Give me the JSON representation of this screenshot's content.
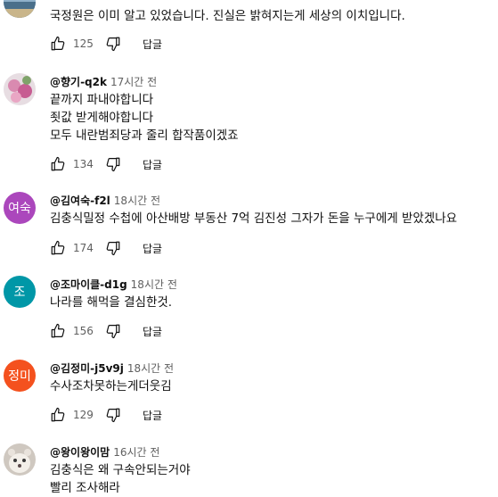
{
  "comments": [
    {
      "author": "",
      "time": "",
      "avatar_text": "",
      "avatar_kind": "photo-sea",
      "lines": [
        "국정원은 이미 알고 있었습니다.  진실은 밝혀지는게 세상의 이치입니다."
      ],
      "likes": "125",
      "reply_label": "답글"
    },
    {
      "author": "@향기-q2k",
      "time": "17시간 전",
      "avatar_text": "",
      "avatar_kind": "photo-flower",
      "lines": [
        "끝까지 파내야합니다",
        "죗값 받게해야합니다",
        "모두 내란범죄당과  줄리 합작품이겠죠"
      ],
      "likes": "134",
      "reply_label": "답글"
    },
    {
      "author": "@김여숙-f2l",
      "time": "18시간 전",
      "avatar_text": "여숙",
      "avatar_color": "#ab47bc",
      "lines": [
        "김충식밀정 수첩에 아산배방 부동산 7억 김진성 그자가 돈을 누구에게 받았겠나요"
      ],
      "likes": "174",
      "reply_label": "답글"
    },
    {
      "author": "@조마이클-d1g",
      "time": "18시간 전",
      "avatar_text": "조",
      "avatar_color": "#0097a7",
      "lines": [
        "나라를 해먹을 결심한것."
      ],
      "likes": "156",
      "reply_label": "답글"
    },
    {
      "author": "@김정미-j5v9j",
      "time": "18시간 전",
      "avatar_text": "정미",
      "avatar_color": "#f4511e",
      "lines": [
        "수사조차못하는게더웃김"
      ],
      "likes": "129",
      "reply_label": "답글"
    },
    {
      "author": "@왕이왕이맘",
      "time": "16시간 전",
      "avatar_text": "",
      "avatar_kind": "photo-pet",
      "lines": [
        "김충식은 왜 구속안되는거야",
        "빨리 조사해라"
      ],
      "likes": "",
      "reply_label": ""
    }
  ]
}
